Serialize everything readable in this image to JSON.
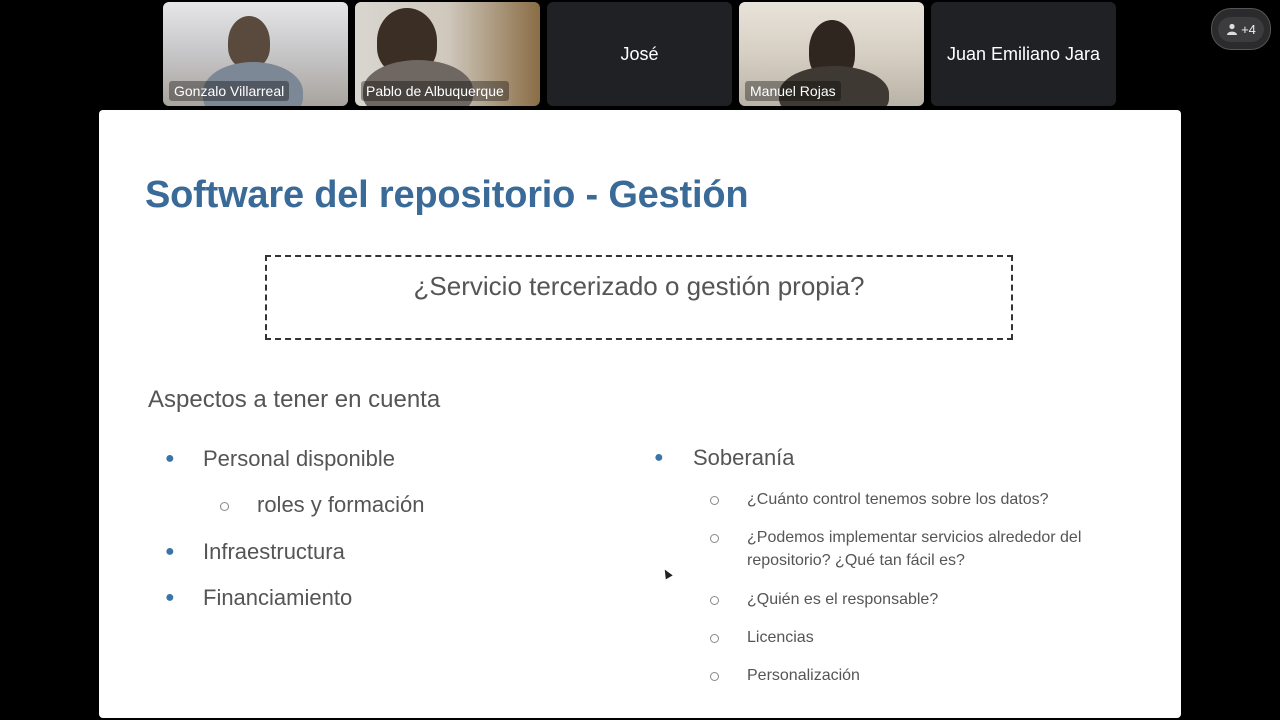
{
  "participants": [
    {
      "name": "Gonzalo Villarreal",
      "video": true
    },
    {
      "name": "Pablo de Albuquerque",
      "video": true
    },
    {
      "name": "José",
      "video": false
    },
    {
      "name": "Manuel Rojas",
      "video": true
    },
    {
      "name": "Juan Emiliano Jara",
      "video": false
    }
  ],
  "more_participants": {
    "label": "+4",
    "icon": "person-icon"
  },
  "slide": {
    "title": "Software del repositorio - Gestión",
    "question": "¿Servicio tercerizado o gestión propia?",
    "aspects_heading": "Aspectos a tener en cuenta",
    "left_list": {
      "personal": "Personal disponible",
      "personal_sub": "roles y formación",
      "infra": "Infraestructura",
      "finance": "Financiamiento"
    },
    "right_list": {
      "heading": "Soberanía",
      "items": [
        "¿Cuánto control tenemos sobre los datos?",
        "¿Podemos implementar servicios alrededor del repositorio? ¿Qué tan fácil es?",
        "¿Quién es el responsable?",
        "Licencias",
        "Personalización"
      ]
    },
    "colors": {
      "title": "#3a6a98",
      "bullet": "#3a74a8",
      "text": "#555555"
    }
  }
}
